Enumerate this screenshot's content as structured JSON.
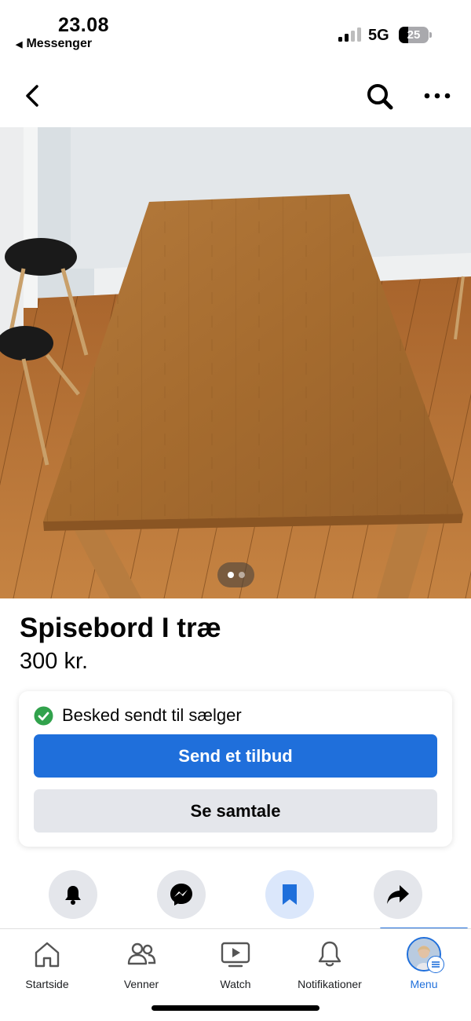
{
  "status_bar": {
    "time": "23.08",
    "back_app": "Messenger",
    "network": "5G",
    "battery_level": "25"
  },
  "listing": {
    "title": "Spisebord I træ",
    "price": "300 kr.",
    "photo": {
      "current": 1,
      "total": 2
    }
  },
  "message_card": {
    "status": "Besked sendt til sælger",
    "primary_button": "Send et tilbud",
    "secondary_button": "Se samtale"
  },
  "actions": [
    {
      "icon": "bell-icon"
    },
    {
      "icon": "messenger-icon"
    },
    {
      "icon": "bookmark-icon",
      "selected": true
    },
    {
      "icon": "share-icon"
    }
  ],
  "tabs": [
    {
      "label": "Startside",
      "icon": "home-icon"
    },
    {
      "label": "Venner",
      "icon": "friends-icon"
    },
    {
      "label": "Watch",
      "icon": "watch-icon"
    },
    {
      "label": "Notifikationer",
      "icon": "bell-icon"
    },
    {
      "label": "Menu",
      "icon": "avatar",
      "active": true
    }
  ],
  "colors": {
    "accent": "#1f6fdb",
    "secondary_button": "#e4e6eb",
    "success": "#31a24c"
  }
}
